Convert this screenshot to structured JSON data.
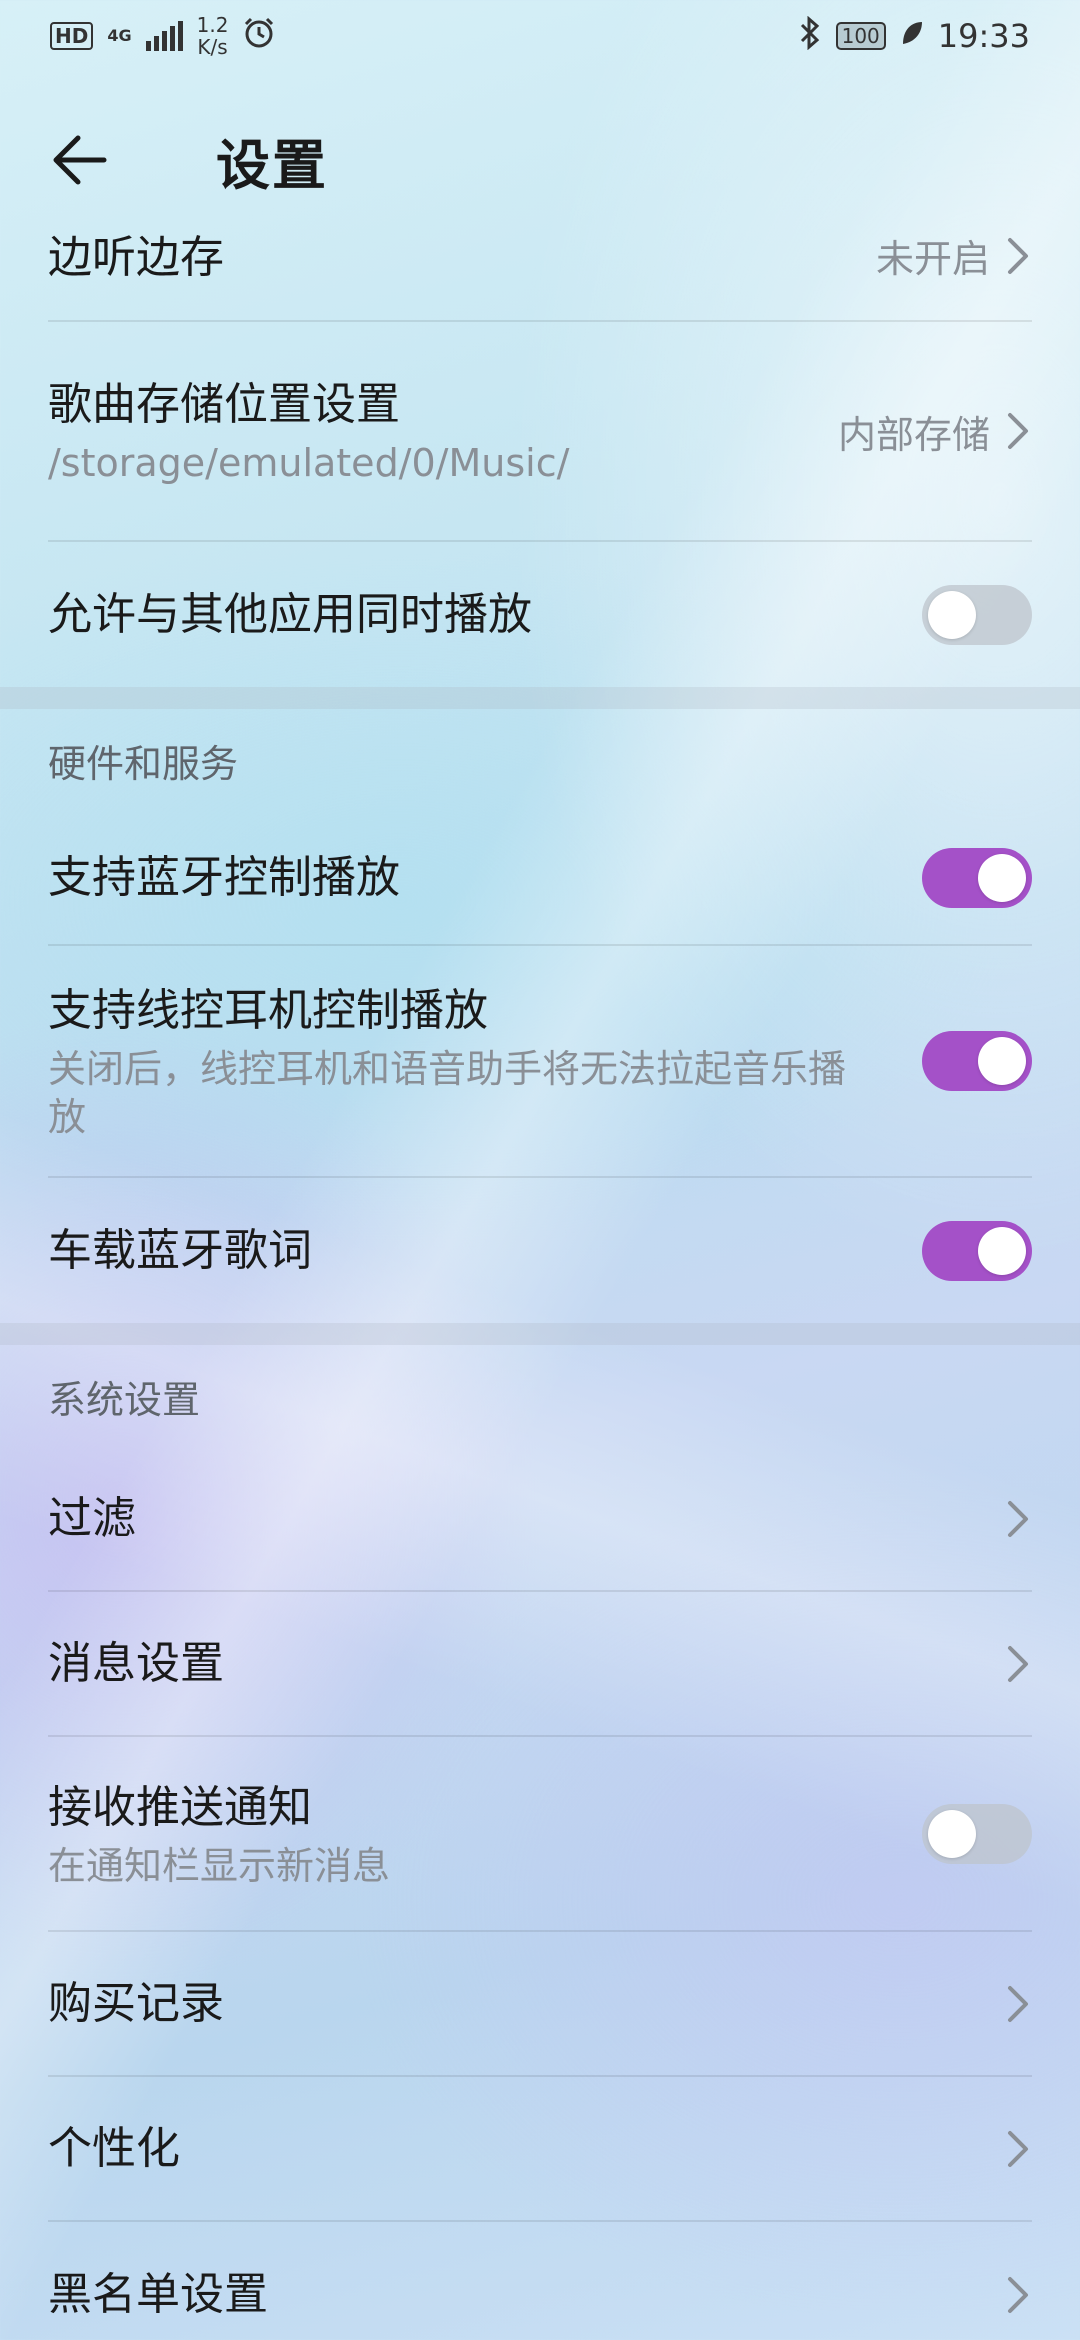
{
  "statusbar": {
    "hd": "HD",
    "network": "4G",
    "speed_value": "1.2",
    "speed_unit": "K/s",
    "battery": "100",
    "time": "19:33"
  },
  "header": {
    "title": "设置"
  },
  "rows": {
    "listen_cache": {
      "title": "边听边存",
      "value": "未开启"
    },
    "storage": {
      "title": "歌曲存储位置设置",
      "sub": "/storage/emulated/0/Music/",
      "value": "内部存储"
    },
    "simultaneous": {
      "title": "允许与其他应用同时播放",
      "toggle": false
    }
  },
  "hardware": {
    "section_title": "硬件和服务",
    "bluetooth_control": {
      "title": "支持蓝牙控制播放",
      "toggle": true
    },
    "wired_control": {
      "title": "支持线控耳机控制播放",
      "sub": "关闭后，线控耳机和语音助手将无法拉起音乐播放",
      "toggle": true
    },
    "car_lyrics": {
      "title": "车载蓝牙歌词",
      "toggle": true
    }
  },
  "system": {
    "section_title": "系统设置",
    "filter": {
      "title": "过滤"
    },
    "messages": {
      "title": "消息设置"
    },
    "push": {
      "title": "接收推送通知",
      "sub": "在通知栏显示新消息",
      "toggle": false
    },
    "purchases": {
      "title": "购买记录"
    },
    "personalize": {
      "title": "个性化"
    },
    "blacklist": {
      "title": "黑名单设置"
    }
  },
  "colors": {
    "accent": "#a451c8",
    "toggle_off": "#bec4cc"
  }
}
